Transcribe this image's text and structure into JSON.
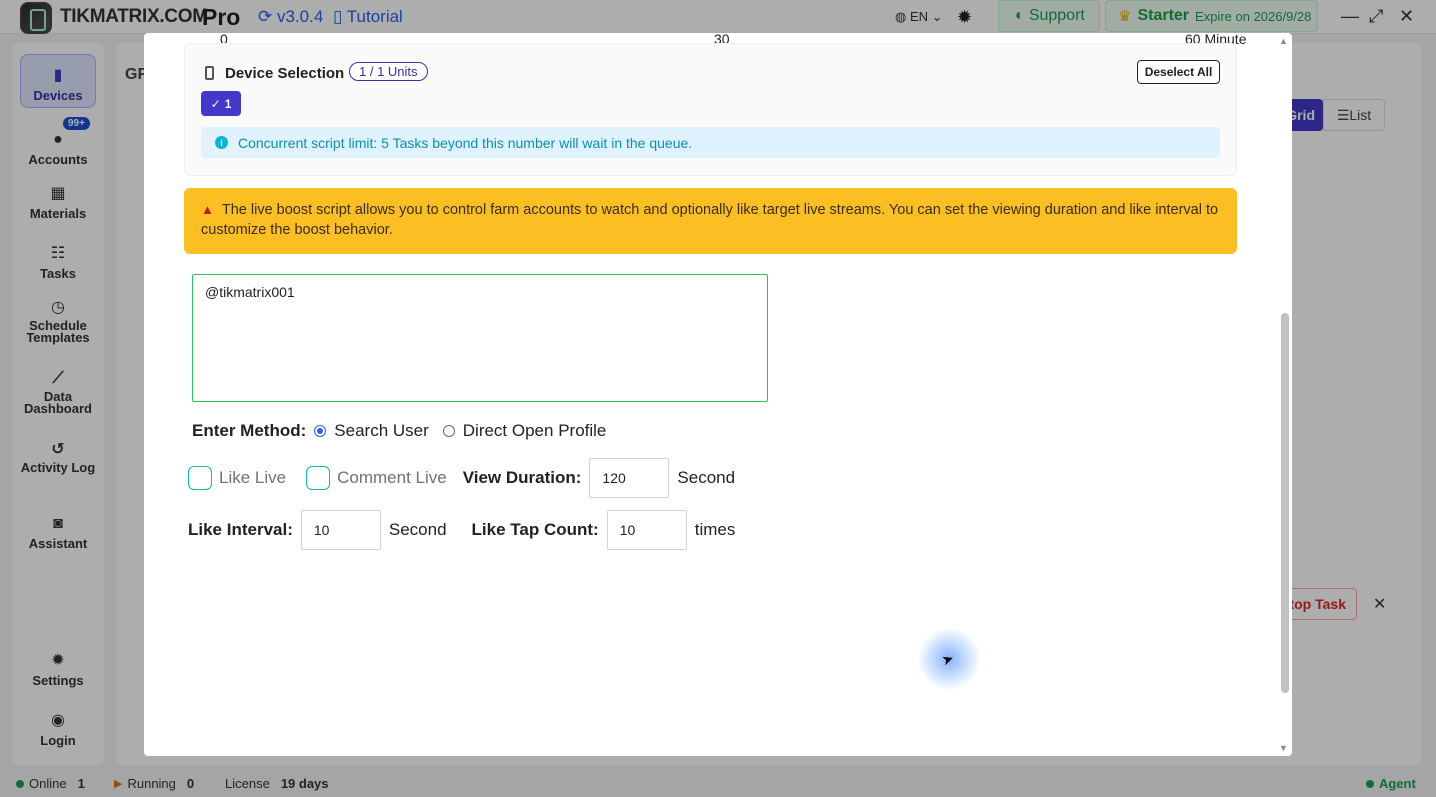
{
  "topbar": {
    "brand": "TIKMATRIX.COM",
    "edition": "Pro",
    "version": "v3.0.4",
    "tutorial": "Tutorial",
    "language": "EN",
    "support": "Support",
    "plan": "Starter",
    "expire": "Expire on 2026/9/28"
  },
  "sidebar": {
    "items": [
      {
        "label": "Devices",
        "icon": "phone-icon",
        "active": true
      },
      {
        "label": "Accounts",
        "icon": "user-icon",
        "badge": "99+"
      },
      {
        "label": "Materials",
        "icon": "film-icon"
      },
      {
        "label": "Tasks",
        "icon": "list-icon"
      },
      {
        "label": "Schedule Templates",
        "icon": "clock-icon"
      },
      {
        "label": "Data Dashboard",
        "icon": "chart-icon"
      },
      {
        "label": "Activity Log",
        "icon": "history-icon"
      },
      {
        "label": "Assistant",
        "icon": "chat-icon"
      },
      {
        "label": "Settings",
        "icon": "gear-icon"
      },
      {
        "label": "Login",
        "icon": "user-circle-icon"
      }
    ]
  },
  "background": {
    "title_fragment": "GF",
    "view_grid": "Grid",
    "view_list": "List",
    "stop_task": "Stop Task"
  },
  "modal": {
    "scale": {
      "min": "0",
      "mid": "30",
      "max": "60 Minute"
    },
    "device_selection": {
      "title": "Device Selection",
      "units_badge": "1 / 1 Units",
      "deselect_all": "Deselect All",
      "device_chip": "1"
    },
    "concurrency_info": "Concurrent script limit: 5 Tasks beyond this number will wait in the queue.",
    "warning": "The live boost script allows you to control farm accounts to watch and optionally like target live streams. You can set the viewing duration and like interval to customize the boost behavior.",
    "target_users": "@tikmatrix001",
    "enter_method": {
      "label": "Enter Method:",
      "options": [
        "Search User",
        "Direct Open Profile"
      ],
      "selected": "Search User"
    },
    "like_live": "Like Live",
    "comment_live": "Comment Live",
    "view_duration": {
      "label": "View Duration:",
      "value": "120",
      "unit": "Second"
    },
    "like_interval": {
      "label": "Like Interval:",
      "value": "10",
      "unit": "Second"
    },
    "like_tap_count": {
      "label": "Like Tap Count:",
      "value": "10",
      "unit": "times"
    }
  },
  "statusbar": {
    "online_label": "Online",
    "online_count": "1",
    "running_label": "Running",
    "running_count": "0",
    "license_label": "License",
    "license_value": "19 days",
    "agent": "Agent"
  },
  "colors": {
    "accent": "#4338ca",
    "success": "#16a34a",
    "warning_bg": "#fbbf24",
    "info_bg": "#e0f2fe"
  }
}
